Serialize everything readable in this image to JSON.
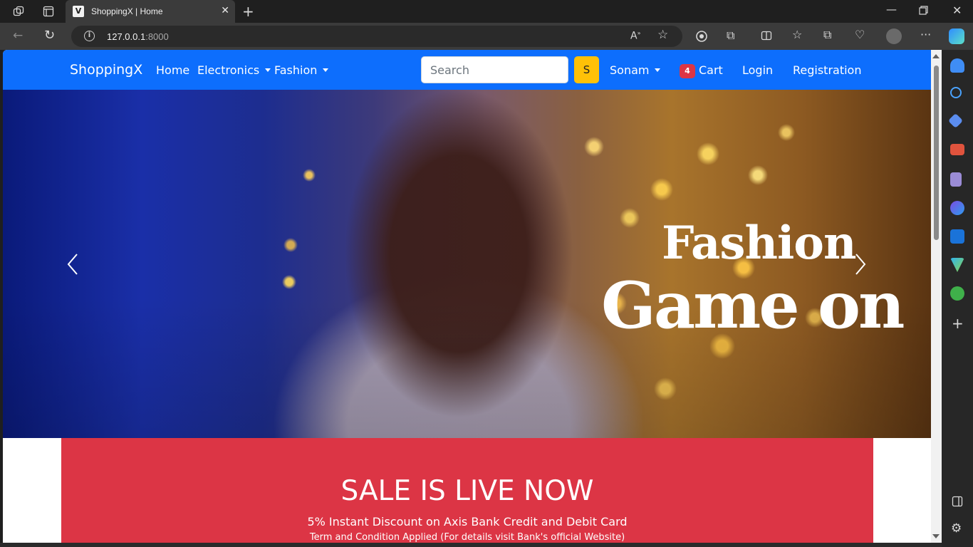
{
  "browser": {
    "tab": {
      "title": "ShoppingX | Home",
      "favicon": "V"
    },
    "address": {
      "host": "127.0.0.1",
      "port": ":8000"
    }
  },
  "navbar": {
    "brand": "ShoppingX",
    "links": {
      "home": "Home",
      "electronics": "Electronics",
      "fashion": "Fashion"
    },
    "search": {
      "placeholder": "Search",
      "button_label": "S"
    },
    "user": "Sonam",
    "cart": {
      "count": "4",
      "label": "Cart"
    },
    "login": "Login",
    "registration": "Registration"
  },
  "hero": {
    "line1": "Fashion",
    "line2": "Game on"
  },
  "sale": {
    "title": "SALE IS LIVE NOW",
    "subtitle": "5% Instant Discount on Axis Bank Credit and Debit Card",
    "note": "Term and Condition Applied (For details visit Bank's official Website)"
  },
  "colors": {
    "navbar": "#0d6efd",
    "search_button": "#ffc107",
    "badge": "#dc3545",
    "sale_banner": "#dc3545"
  }
}
